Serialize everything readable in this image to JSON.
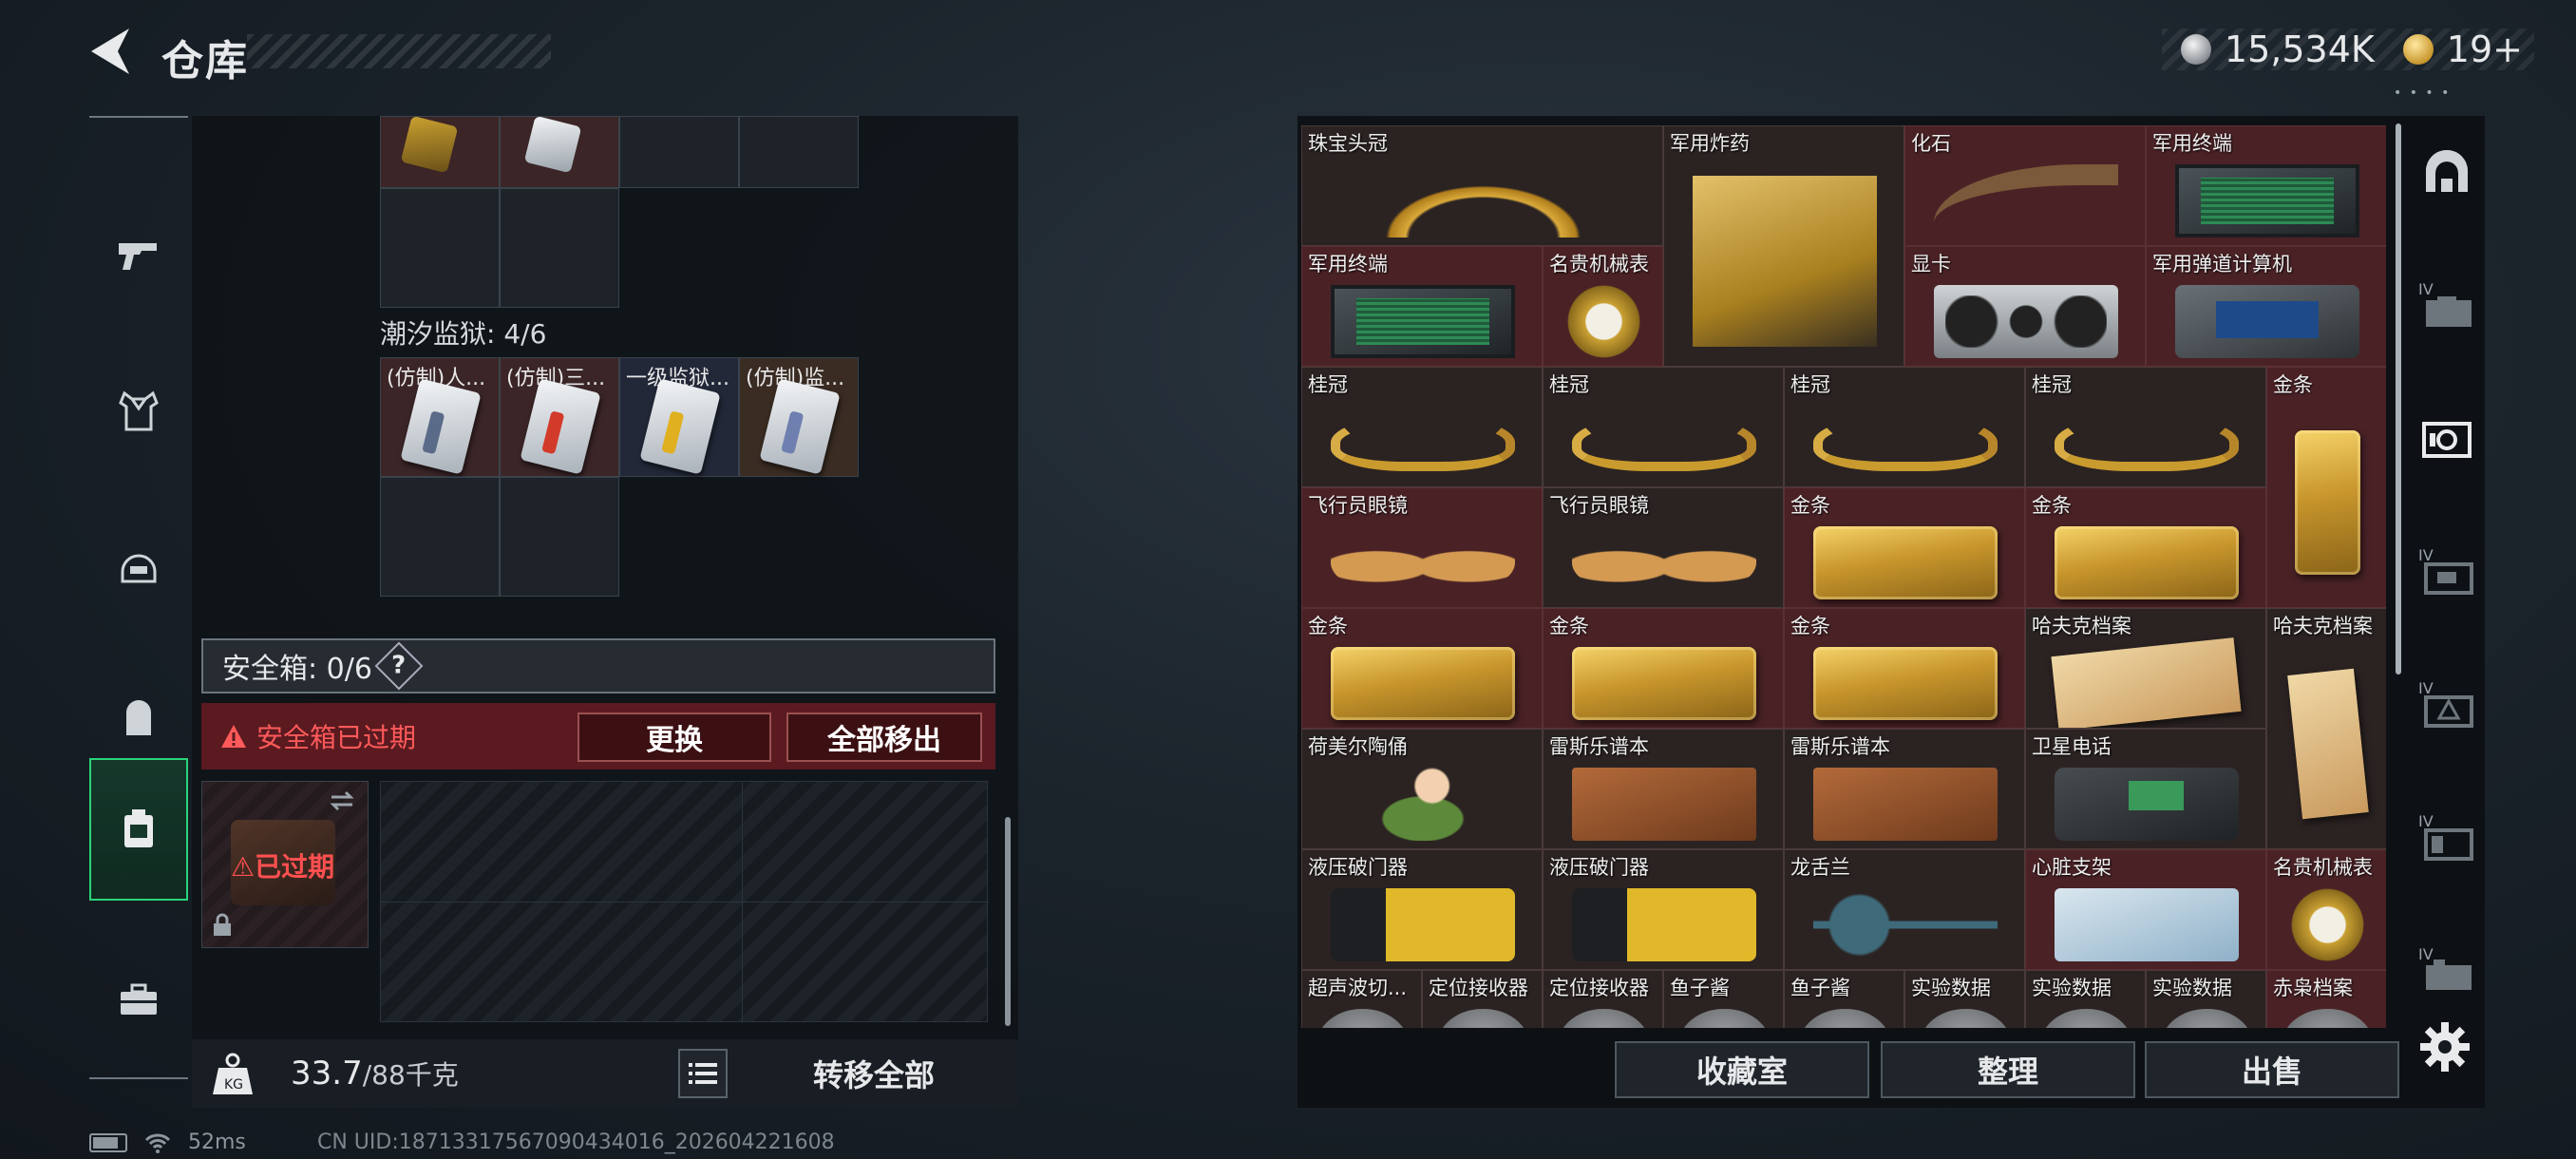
{
  "header": {
    "title": "仓库",
    "silver_amount": "15,534K",
    "gold_amount": "19+"
  },
  "left": {
    "top_row_cells": 4,
    "section_title": "潮汐监狱: 4/6",
    "keycards": [
      {
        "label": "(仿制)人...",
        "style": "red",
        "card": "card-a"
      },
      {
        "label": "(仿制)三...",
        "style": "red",
        "card": "card-b"
      },
      {
        "label": "一级监狱...",
        "style": "blue",
        "card": "card-c"
      },
      {
        "label": "(仿制)监...",
        "style": "brown",
        "card": "card-d"
      }
    ],
    "safe_box": {
      "label": "安全箱: 0/6",
      "help": "?",
      "expired_notice": "安全箱已过期",
      "replace_button": "更换",
      "move_all_button": "全部移出",
      "item_status": "已过期"
    },
    "weight": {
      "current": "33.7",
      "capacity": "/88千克"
    },
    "transfer_all_button": "转移全部"
  },
  "stash": {
    "items": [
      {
        "name": "珠宝头冠",
        "art": "crown",
        "red": false
      },
      {
        "name": "军用炸药",
        "art": "box",
        "red": false
      },
      {
        "name": "化石",
        "art": "fossil",
        "red": true
      },
      {
        "name": "军用终端",
        "art": "terminal",
        "red": true
      },
      {
        "name": "军用终端",
        "art": "terminal",
        "red": true
      },
      {
        "name": "名贵机械表",
        "art": "watch",
        "red": true
      },
      {
        "name": "显卡",
        "art": "gpu",
        "red": true
      },
      {
        "name": "军用弹道计算机",
        "art": "computer",
        "red": true
      },
      {
        "name": "桂冠",
        "art": "laurel",
        "red": false
      },
      {
        "name": "桂冠",
        "art": "laurel",
        "red": false
      },
      {
        "name": "桂冠",
        "art": "laurel",
        "red": false
      },
      {
        "name": "桂冠",
        "art": "laurel",
        "red": false
      },
      {
        "name": "金条",
        "art": "goldbar-v",
        "red": true
      },
      {
        "name": "飞行员眼镜",
        "art": "glasses",
        "red": true
      },
      {
        "name": "飞行员眼镜",
        "art": "glasses",
        "red": false
      },
      {
        "name": "金条",
        "art": "goldbar",
        "red": true
      },
      {
        "name": "金条",
        "art": "goldbar",
        "red": true
      },
      {
        "name": "金条",
        "art": "goldbar",
        "red": true
      },
      {
        "name": "金条",
        "art": "goldbar",
        "red": true
      },
      {
        "name": "金条",
        "art": "goldbar",
        "red": true
      },
      {
        "name": "哈夫克档案",
        "art": "folder",
        "red": false
      },
      {
        "name": "哈夫克档案",
        "art": "folder-v",
        "red": false
      },
      {
        "name": "荷美尔陶俑",
        "art": "figurine",
        "red": false
      },
      {
        "name": "雷斯乐谱本",
        "art": "book",
        "red": false
      },
      {
        "name": "雷斯乐谱本",
        "art": "book",
        "red": false
      },
      {
        "name": "卫星电话",
        "art": "phone",
        "red": false
      },
      {
        "name": "液压破门器",
        "art": "breacher",
        "red": false
      },
      {
        "name": "液压破门器",
        "art": "breacher",
        "red": false
      },
      {
        "name": "龙舌兰",
        "art": "orchid",
        "red": false
      },
      {
        "name": "心脏支架",
        "art": "heart",
        "red": true
      },
      {
        "name": "名贵机械表",
        "art": "watch",
        "red": true
      },
      {
        "name": "超声波切...",
        "art": "round",
        "red": false
      },
      {
        "name": "定位接收器",
        "art": "round",
        "red": false
      },
      {
        "name": "定位接收器",
        "art": "round",
        "red": false
      },
      {
        "name": "鱼子酱",
        "art": "round",
        "red": false
      },
      {
        "name": "鱼子酱",
        "art": "round",
        "red": false
      },
      {
        "name": "实验数据",
        "art": "round",
        "red": false
      },
      {
        "name": "实验数据",
        "art": "round",
        "red": false
      },
      {
        "name": "实验数据",
        "art": "round",
        "red": false
      },
      {
        "name": "赤枭档案",
        "art": "round",
        "red": true
      }
    ]
  },
  "actions": {
    "collection_button": "收藏室",
    "sort_button": "整理",
    "sell_button": "出售"
  },
  "status_bar": {
    "ping": "52ms",
    "uid": "CN UID:18713317567090434016_202604221608"
  },
  "right_sidebar_tier": "IV"
}
